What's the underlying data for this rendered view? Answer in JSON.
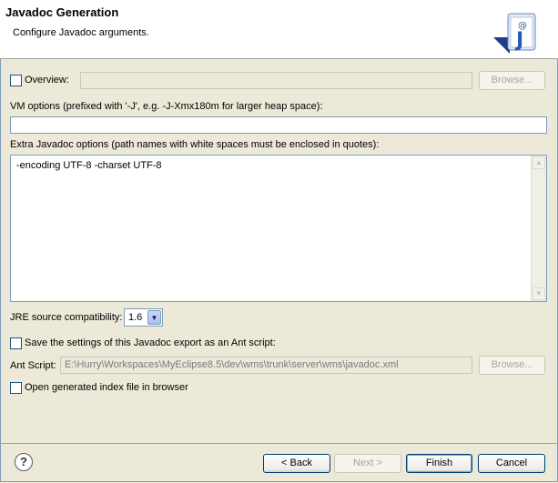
{
  "header": {
    "title": "Javadoc Generation",
    "subtitle": "Configure Javadoc arguments.",
    "icon": "javadoc-wizard-icon"
  },
  "overview": {
    "label": "Overview:",
    "checked": false,
    "value": "",
    "browse_label": "Browse..."
  },
  "vm_options": {
    "label": "VM options (prefixed with '-J', e.g. -J-Xmx180m for larger heap space):",
    "value": ""
  },
  "extra_options": {
    "label": "Extra Javadoc options (path names with white spaces must be enclosed in quotes):",
    "value": "-encoding UTF-8 -charset UTF-8"
  },
  "jre": {
    "label": "JRE source compatibility:",
    "value": "1.6"
  },
  "save_ant": {
    "label": "Save the settings of this Javadoc export as an Ant script:",
    "checked": false
  },
  "ant_script": {
    "label": "Ant Script:",
    "value": "E:\\Hurry\\Workspaces\\MyEclipse8.5\\dev\\wms\\trunk\\server\\wms\\javadoc.xml",
    "browse_label": "Browse..."
  },
  "open_index": {
    "label": "Open generated index file in browser",
    "checked": false
  },
  "footer": {
    "help": "?",
    "back_label": "< Back",
    "next_label": "Next >",
    "finish_label": "Finish",
    "cancel_label": "Cancel"
  }
}
